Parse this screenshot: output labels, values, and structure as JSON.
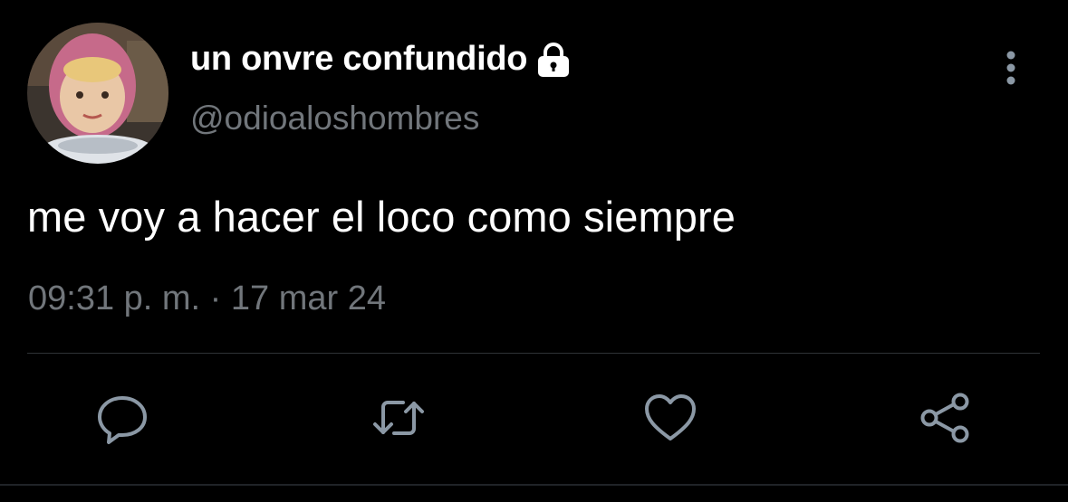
{
  "tweet": {
    "display_name": "un onvre confundido",
    "handle": "@odioaloshombres",
    "text": "me voy a hacer el loco como siempre",
    "timestamp": "09:31 p. m. · 17 mar 24",
    "protected": true
  },
  "icons": {
    "lock": "lock-icon",
    "more": "more-vertical-icon",
    "reply": "reply-icon",
    "retweet": "retweet-icon",
    "like": "heart-icon",
    "share": "share-icon"
  },
  "colors": {
    "background": "#000000",
    "primary_text": "#ffffff",
    "secondary_text": "#71767b",
    "divider": "#2f3336"
  }
}
